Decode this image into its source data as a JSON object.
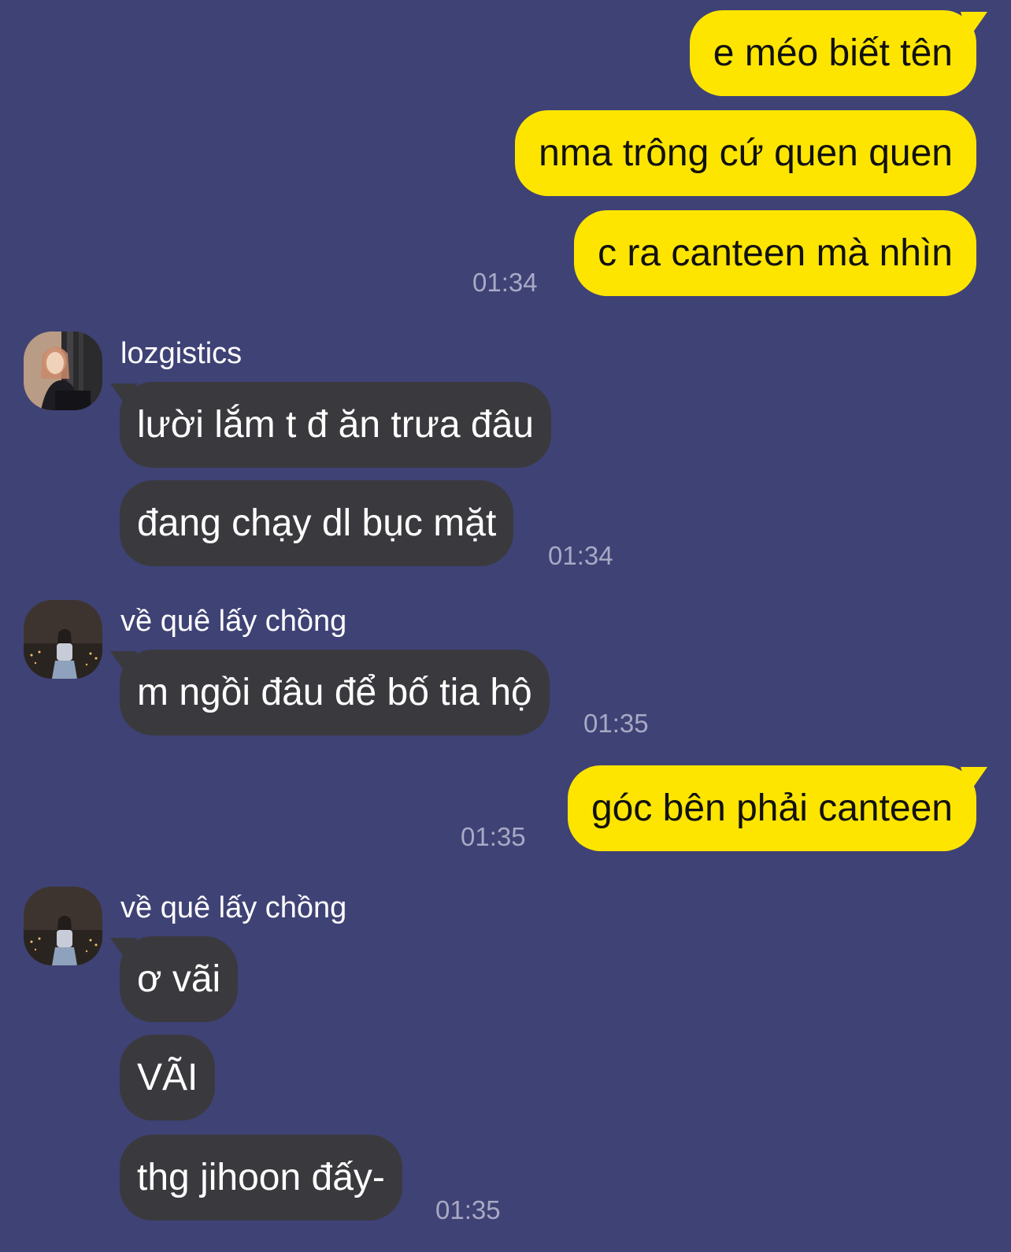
{
  "colors": {
    "background": "#3f4275",
    "outgoing_bubble": "#fee500",
    "incoming_bubble": "#3a3a3e",
    "timestamp": "#a8a9c4"
  },
  "messages": {
    "out1": "e méo biết tên",
    "out2": "nma trông cứ quen quen",
    "out3": "c ra canteen mà nhìn",
    "out3_time": "01:34",
    "sender1_name": "lozgistics",
    "sender1_avatar": "avatar",
    "in1": "lười lắm t đ ăn trưa đâu",
    "in2": "đang chạy dl bục mặt",
    "in2_time": "01:34",
    "sender2_name": "về quê lấy chồng",
    "sender2_avatar": "avatar",
    "in3": "m ngồi đâu để bố tia hộ",
    "in3_time": "01:35",
    "out4": "góc bên phải canteen",
    "out4_time": "01:35",
    "sender3_name": "về quê lấy chồng",
    "sender3_avatar": "avatar",
    "in4": "ơ vãi",
    "in5": "VÃI",
    "in6": "thg jihoon đấy-",
    "in6_time": "01:35"
  }
}
